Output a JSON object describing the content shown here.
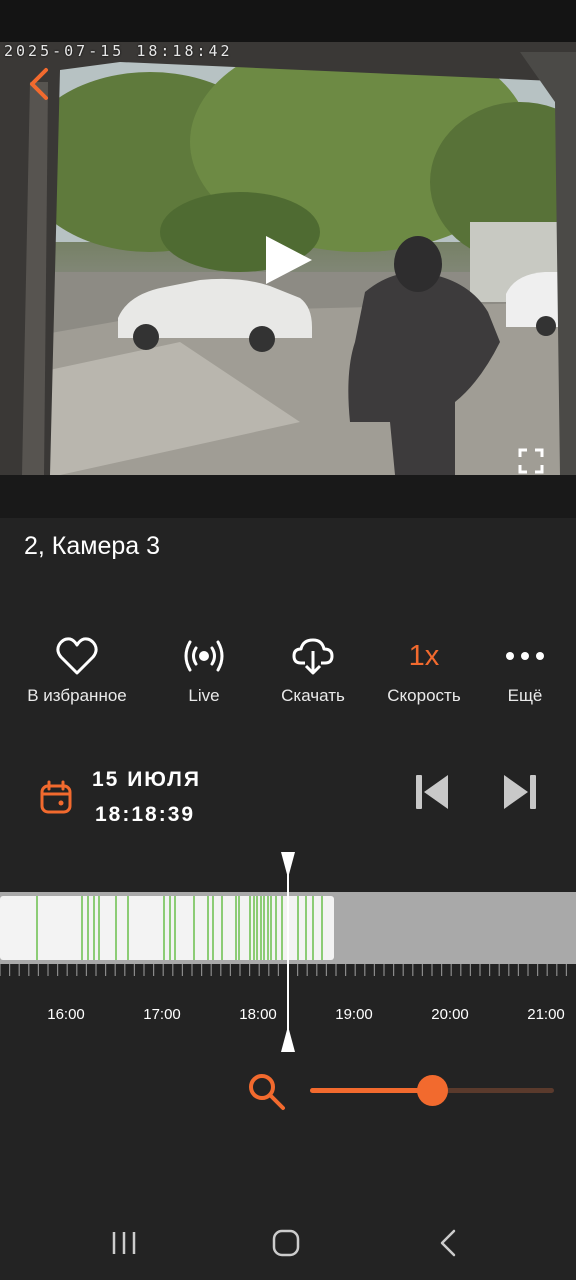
{
  "video": {
    "timestamp": "2025-07-15 18:18:42"
  },
  "camera": {
    "title": "2, Камера 3"
  },
  "actions": [
    {
      "label": "В избранное",
      "icon": "heart-icon"
    },
    {
      "label": "Live",
      "icon": "broadcast-icon"
    },
    {
      "label": "Скачать",
      "icon": "cloud-download-icon"
    },
    {
      "value": "1x",
      "label": "Скорость"
    },
    {
      "label": "Ещё",
      "icon": "more-icon"
    }
  ],
  "playback": {
    "date": "15 ИЮЛЯ",
    "time": "18:18:39"
  },
  "timeline": {
    "hours": [
      "16:00",
      "17:00",
      "18:00",
      "19:00",
      "20:00",
      "21:00"
    ],
    "recording_end": "18:47",
    "cursor": "18:18"
  },
  "zoom": {
    "level": 0.5
  },
  "colors": {
    "accent": "#f26a2e",
    "background": "#232323",
    "event_marker": "#6abf4b"
  }
}
